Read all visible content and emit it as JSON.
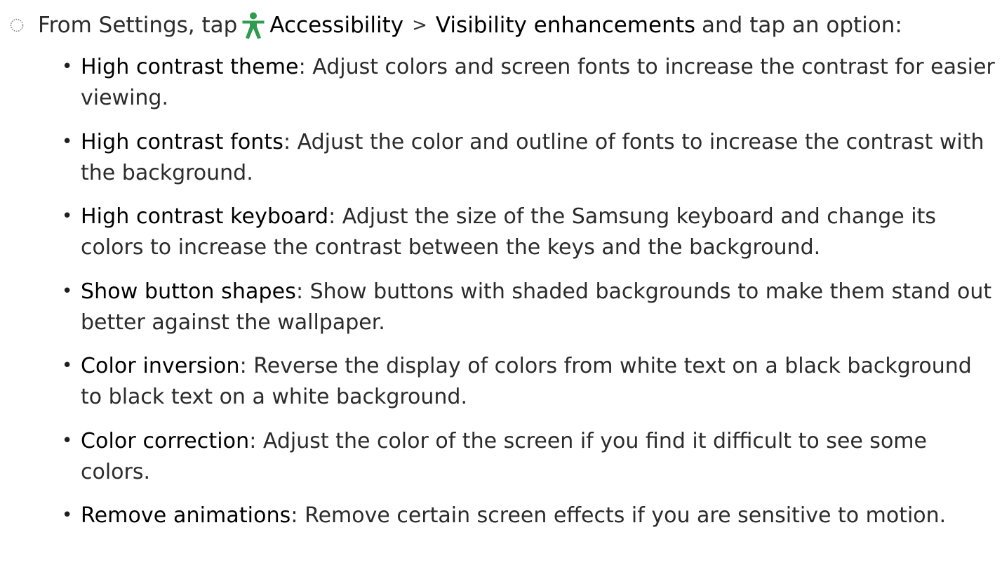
{
  "intro": {
    "lead": "From Settings, tap",
    "menu_accessibility": "Accessibility",
    "separator": ">",
    "menu_visibility": "Visibility enhancements",
    "tail": "and tap an option:",
    "step_icon": "step-circle-icon",
    "accessibility_icon": "accessibility-person-icon",
    "accent_color": "#2e9b4e"
  },
  "options": [
    {
      "name": "High contrast theme",
      "description": ": Adjust colors and screen fonts to increase the contrast for easier viewing."
    },
    {
      "name": "High contrast fonts",
      "description": ": Adjust the color and outline of fonts to increase the contrast with the background."
    },
    {
      "name": "High contrast keyboard",
      "description": ": Adjust the size of the Samsung keyboard and change its colors to increase the contrast between the keys and the background."
    },
    {
      "name": "Show button shapes",
      "description": ": Show buttons with shaded backgrounds to make them stand out better against the wallpaper."
    },
    {
      "name": "Color inversion",
      "description": ": Reverse the display of colors from white text on a black background to black text on a white background."
    },
    {
      "name": "Color correction",
      "description": ": Adjust the color of the screen if you find it difficult to see some colors."
    },
    {
      "name": "Remove animations",
      "description": ": Remove certain screen effects if you are sensitive to motion."
    }
  ]
}
